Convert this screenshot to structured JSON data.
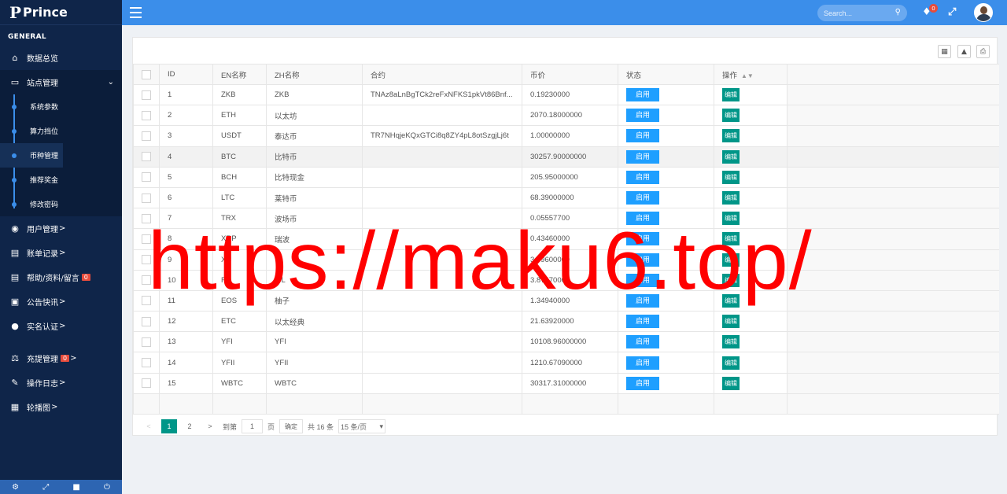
{
  "app": {
    "brand": "Prince",
    "brand_mark": "P"
  },
  "sidebar": {
    "section_title": "GENERAL",
    "items": [
      {
        "label": "数据总览",
        "icon": "home-icon"
      },
      {
        "label": "站点管理",
        "icon": "monitor-icon",
        "expanded": true
      },
      {
        "label": "用户管理",
        "icon": "user-circle-icon"
      },
      {
        "label": "账单记录",
        "icon": "money-icon"
      },
      {
        "label": "帮助/资料/留言",
        "icon": "money-icon",
        "badge": "0"
      },
      {
        "label": "公告快讯",
        "icon": "window-icon"
      },
      {
        "label": "实名认证",
        "icon": "user-icon"
      },
      {
        "label": "充提管理",
        "icon": "balance-icon",
        "badge": "0"
      },
      {
        "label": "操作日志",
        "icon": "edit-icon"
      },
      {
        "label": "轮播图",
        "icon": "image-icon"
      }
    ],
    "subitems": [
      "系统参数",
      "算力挡位",
      "币种管理",
      "推荐奖金",
      "修改密码"
    ],
    "active_subitem": "币种管理",
    "arrow": ">"
  },
  "topbar": {
    "search_placeholder": "Search...",
    "notification_count": "0"
  },
  "table": {
    "headers": [
      "ID",
      "EN名称",
      "ZH名称",
      "合约",
      "币价",
      "状态",
      "操作"
    ],
    "status_label": "启用",
    "edit_label": "编辑",
    "rows": [
      {
        "id": "1",
        "en": "ZKB",
        "zh": "ZKB",
        "contract": "TNAz8aLnBgTCk2reFxNFKS1pkVt86Bnf...",
        "price": "0.19230000"
      },
      {
        "id": "2",
        "en": "ETH",
        "zh": "以太坊",
        "contract": "",
        "price": "2070.18000000"
      },
      {
        "id": "3",
        "en": "USDT",
        "zh": "泰达币",
        "contract": "TR7NHqjeKQxGTCi8q8ZY4pL8otSzgjLj6t",
        "price": "1.00000000"
      },
      {
        "id": "4",
        "en": "BTC",
        "zh": "比特币",
        "contract": "",
        "price": "30257.90000000"
      },
      {
        "id": "5",
        "en": "BCH",
        "zh": "比特现金",
        "contract": "",
        "price": "205.95000000"
      },
      {
        "id": "6",
        "en": "LTC",
        "zh": "莱特币",
        "contract": "",
        "price": "68.39000000"
      },
      {
        "id": "7",
        "en": "TRX",
        "zh": "波场币",
        "contract": "",
        "price": "0.05557700"
      },
      {
        "id": "8",
        "en": "XRP",
        "zh": "瑞波",
        "contract": "",
        "price": "0.43460000"
      },
      {
        "id": "9",
        "en": "XC",
        "zh": "",
        "contract": "",
        "price": "3.69600000"
      },
      {
        "id": "10",
        "en": "FIL",
        "zh": "FIL",
        "contract": "",
        "price": "3.87470000"
      },
      {
        "id": "11",
        "en": "EOS",
        "zh": "柚子",
        "contract": "",
        "price": "1.34940000"
      },
      {
        "id": "12",
        "en": "ETC",
        "zh": "以太经典",
        "contract": "",
        "price": "21.63920000"
      },
      {
        "id": "13",
        "en": "YFI",
        "zh": "YFI",
        "contract": "",
        "price": "10108.96000000"
      },
      {
        "id": "14",
        "en": "YFII",
        "zh": "YFII",
        "contract": "",
        "price": "1210.67090000"
      },
      {
        "id": "15",
        "en": "WBTC",
        "zh": "WBTC",
        "contract": "",
        "price": "30317.31000000"
      }
    ]
  },
  "pagination": {
    "pages": [
      "1",
      "2"
    ],
    "current": "1",
    "goto_label": "到第",
    "goto_value": "1",
    "page_unit": "页",
    "confirm_label": "确定",
    "total_label": "共 16 条",
    "page_size": "15 条/页"
  },
  "watermark": "https://maku6.top/"
}
